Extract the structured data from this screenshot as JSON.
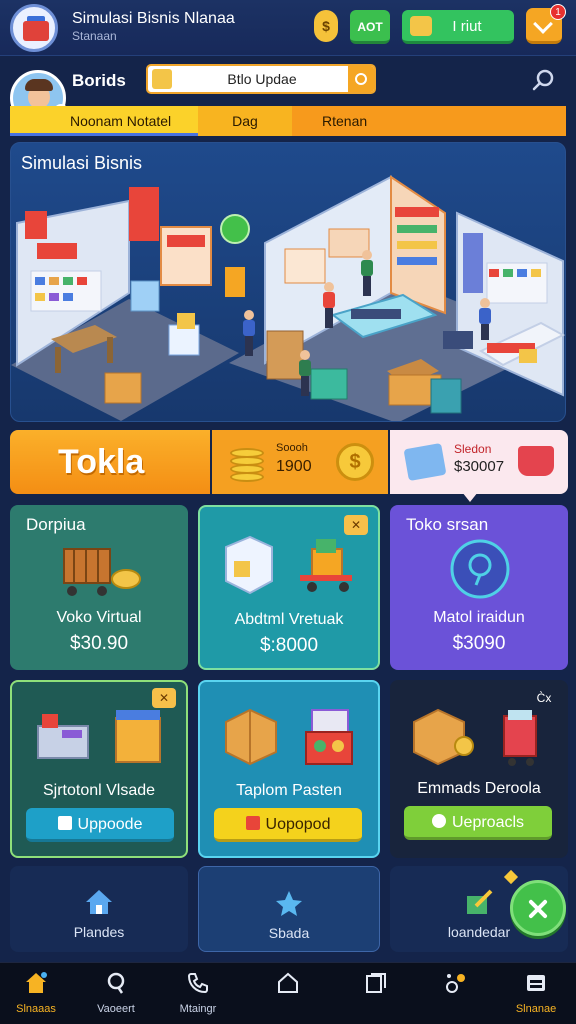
{
  "header": {
    "title": "Simulasi Bisnis Nlanaa",
    "subtitle": "Stanaan",
    "coin_badge": "$",
    "small_button": "AOT",
    "main_button": "I riut",
    "notification_count": "1"
  },
  "profile": {
    "name": "Borids",
    "search_value": "Btlo Updae"
  },
  "tabs": [
    {
      "label": "Noonam Notatel"
    },
    {
      "label": "Dag"
    },
    {
      "label": "Rtenan"
    }
  ],
  "hero": {
    "title": "Simulasi Bisnis"
  },
  "summary": {
    "brand": "Tokla",
    "coins_label": "Soooh",
    "coins_value": "1900",
    "station_label": "Sledon",
    "station_value": "$30007"
  },
  "cards": [
    {
      "header": "Dorpiua",
      "title": "Voko Virtual",
      "price": "$30.90"
    },
    {
      "tag": "✕",
      "title": "Abdtml Vretuak",
      "price": "$:8000"
    },
    {
      "header": "Toko srsan",
      "title": "Matol iraidun",
      "price": "$3090"
    },
    {
      "tag": "✕",
      "title": "Sjrtotonl Vlsade",
      "button": "Uppoode"
    },
    {
      "title": "Taplom Pasten",
      "button": "Uopopod"
    },
    {
      "tag": "C̀x",
      "title": "Emmads Deroola",
      "button": "Ueproacls"
    }
  ],
  "bottom_panels": [
    {
      "label": "Plandes"
    },
    {
      "label": "Sbada"
    },
    {
      "label": "loandedar"
    }
  ],
  "nav": [
    {
      "label": "Slnaaas",
      "active": true
    },
    {
      "label": "Vaoeert"
    },
    {
      "label": "Mtaingr"
    },
    {
      "label": ""
    },
    {
      "label": ""
    },
    {
      "label": ""
    },
    {
      "label": "Slnanae",
      "active": true
    }
  ],
  "colors": {
    "background": "#14244a",
    "accent_orange": "#f7a81b",
    "accent_green": "#33c35f",
    "teal_card": "#2d7b6e",
    "cyan_card": "#1f9aa7",
    "purple_card": "#6b52d8"
  }
}
